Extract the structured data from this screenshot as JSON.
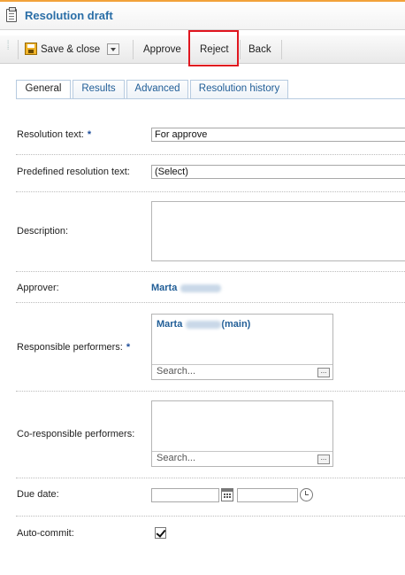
{
  "window": {
    "title": "Resolution draft"
  },
  "toolbar": {
    "save_close": "Save & close",
    "approve": "Approve",
    "reject": "Reject",
    "back": "Back"
  },
  "tabs": [
    {
      "label": "General",
      "active": true
    },
    {
      "label": "Results",
      "active": false
    },
    {
      "label": "Advanced",
      "active": false
    },
    {
      "label": "Resolution history",
      "active": false
    }
  ],
  "form": {
    "resolution_text": {
      "label": "Resolution text:",
      "required": "*",
      "value": "For approve"
    },
    "predefined": {
      "label": "Predefined resolution text:",
      "value": "(Select)"
    },
    "description": {
      "label": "Description:",
      "value": ""
    },
    "approver": {
      "label": "Approver:",
      "value": "Marta"
    },
    "responsible": {
      "label": "Responsible performers:",
      "required": "*",
      "entry_name": "Marta",
      "entry_suffix": "(main)",
      "search_placeholder": "Search..."
    },
    "coresponsible": {
      "label": "Co-responsible performers:",
      "search_placeholder": "Search..."
    },
    "due_date": {
      "label": "Due date:",
      "date": "",
      "time": ""
    },
    "auto_commit": {
      "label": "Auto-commit:",
      "checked": true
    }
  },
  "colors": {
    "accent": "#2a6ea7",
    "highlight": "#e0161f",
    "title_border": "#f2a23a"
  }
}
